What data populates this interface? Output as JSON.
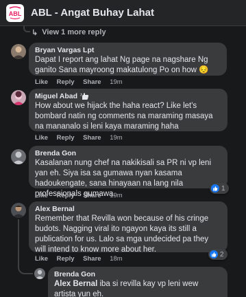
{
  "header": {
    "page_name": "ABL - Angat Buhay Lahat",
    "logo_text": "ABL"
  },
  "view_more": {
    "label": "View 1 more reply"
  },
  "actions": {
    "like": "Like",
    "reply": "Reply",
    "share": "Share"
  },
  "comments": [
    {
      "author": "Bryan Vargas Lpt",
      "text": "Dapat I report ang lahat Ng page na nagshare Ng ganito Sana mayroong makatulong Po on how 😔",
      "time": "19m"
    },
    {
      "author": "Miguel Abad",
      "badge_icon": "top-fan-badge-icon",
      "text": "How about we hijack the haha react? Like let's bombard natin ng comments na maraming masaya na mananalo si leni kaya maraming haha",
      "time": "19m"
    },
    {
      "author": "Brenda Gon",
      "text": "Kasalanan nung chef na nakikisali sa PR ni vp leni yan eh. Siya isa sa gumawa nyan kasama hadoukengate, sana hinayaan na lang nila professionals gumawa.",
      "time": "19m",
      "reaction": {
        "type": "like",
        "count": "1"
      }
    },
    {
      "author": "Alex Bernal",
      "text": "Remember that Revilla won because of his cringe budots. Nagging viral ito ngayon kaya its still a publication for us. Lalo sa mga undecided pa they will intend to know more about her.",
      "time": "18m",
      "reaction": {
        "type": "like",
        "count": "2"
      }
    }
  ],
  "reply": {
    "author": "Brenda Gon",
    "mention": "Alex Bernal",
    "text": " iba si revilla kay vp leni wew artista yun eh."
  },
  "colors": {
    "background": "#18191a",
    "bubble": "#3a3b3c",
    "header": "#242526",
    "like_blue": "#1877f2",
    "logo_pink": "#e91e63"
  }
}
